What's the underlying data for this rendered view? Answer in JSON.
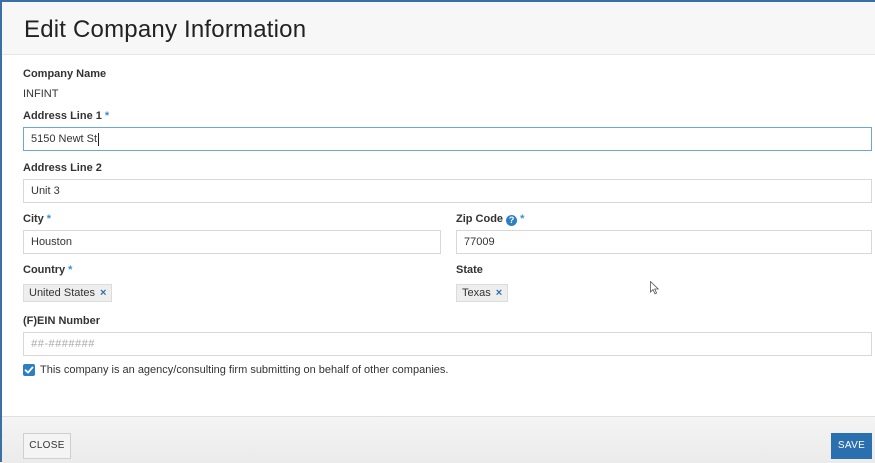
{
  "dialog": {
    "title": "Edit Company Information"
  },
  "form": {
    "company_name": {
      "label": "Company Name",
      "value": "INFINT"
    },
    "address_line_1": {
      "label": "Address Line 1",
      "required": "*",
      "value": "5150 Newt St"
    },
    "address_line_2": {
      "label": "Address Line 2",
      "value": "Unit 3"
    },
    "city": {
      "label": "City",
      "required": "*",
      "value": "Houston"
    },
    "zip_code": {
      "label": "Zip Code",
      "help": "?",
      "required": "*",
      "value": "77009"
    },
    "country": {
      "label": "Country",
      "required": "*",
      "value": "United States",
      "remove": "×"
    },
    "state": {
      "label": "State",
      "value": "Texas",
      "remove": "×"
    },
    "ein": {
      "label": "(F)EIN Number",
      "placeholder": "##-#######"
    },
    "agency_checkbox": {
      "checked": true,
      "label": "This company is an agency/consulting firm submitting on behalf of other companies."
    }
  },
  "footer": {
    "close_label": "CLOSE",
    "save_label": "SAVE"
  },
  "colors": {
    "accent": "#2e7ec2",
    "save_button": "#2a6fae"
  }
}
